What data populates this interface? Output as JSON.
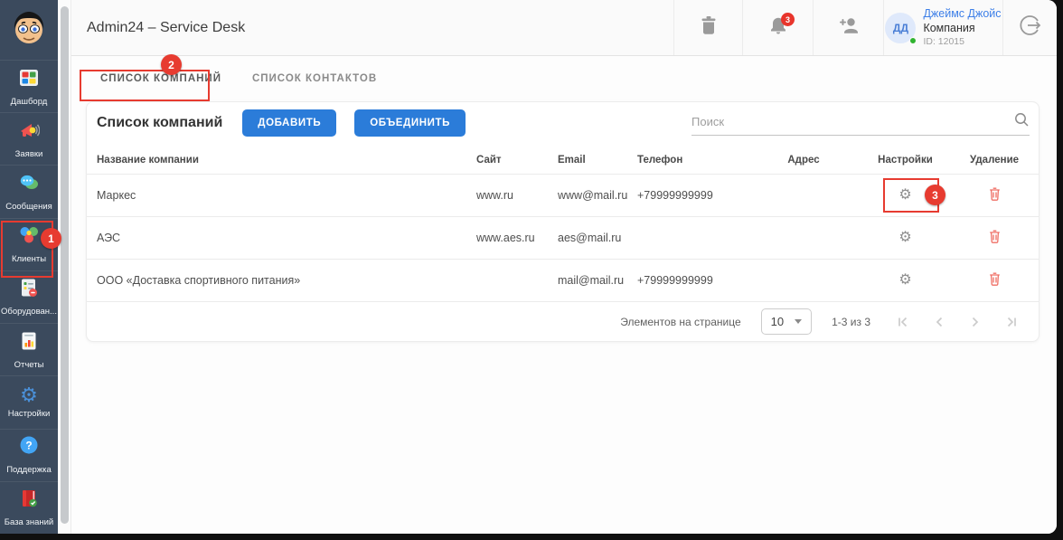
{
  "header": {
    "title": "Admin24 – Service Desk",
    "notifications_badge": "3",
    "user": {
      "initials": "ДД",
      "name": "Джеймс Джойс",
      "company": "Компания",
      "id_label": "ID: 12015"
    }
  },
  "sidebar": {
    "items": [
      {
        "label": "Дашборд"
      },
      {
        "label": "Заявки"
      },
      {
        "label": "Сообщения"
      },
      {
        "label": "Клиенты"
      },
      {
        "label": "Оборудован..."
      },
      {
        "label": "Отчеты"
      },
      {
        "label": "Настройки"
      },
      {
        "label": "Поддержка"
      },
      {
        "label": "База знаний"
      }
    ]
  },
  "tabs": [
    {
      "label": "СПИСОК КОМПАНИЙ",
      "active": true
    },
    {
      "label": "СПИСОК КОНТАКТОВ",
      "active": false
    }
  ],
  "panel": {
    "title": "Список компаний",
    "buttons": {
      "add": "ДОБАВИТЬ",
      "merge": "ОБЪЕДИНИТЬ"
    },
    "search_placeholder": "Поиск",
    "table": {
      "columns": [
        "Название компании",
        "Сайт",
        "Email",
        "Телефон",
        "Адрес",
        "Настройки",
        "Удаление"
      ],
      "rows": [
        {
          "name": "Маркес",
          "site": "www.ru",
          "email": "www@mail.ru",
          "phone": "+79999999999",
          "address": ""
        },
        {
          "name": "АЭС",
          "site": "www.aes.ru",
          "email": "aes@mail.ru",
          "phone": "",
          "address": ""
        },
        {
          "name": "ООО «Доставка спортивного питания»",
          "site": "",
          "email": "mail@mail.ru",
          "phone": "+79999999999",
          "address": ""
        }
      ]
    },
    "pagination": {
      "items_per_page_label": "Элементов на странице",
      "per_page": "10",
      "range_label": "1-3 из 3"
    }
  },
  "annotations": {
    "step1": "1",
    "step2": "2",
    "step3": "3"
  },
  "colors": {
    "sidebar_bg": "#3b4a5d",
    "accent_blue": "#2b7cd9",
    "annotation_red": "#e73b30",
    "delete_red": "#ef6e64",
    "link_blue": "#3d7fe8"
  }
}
